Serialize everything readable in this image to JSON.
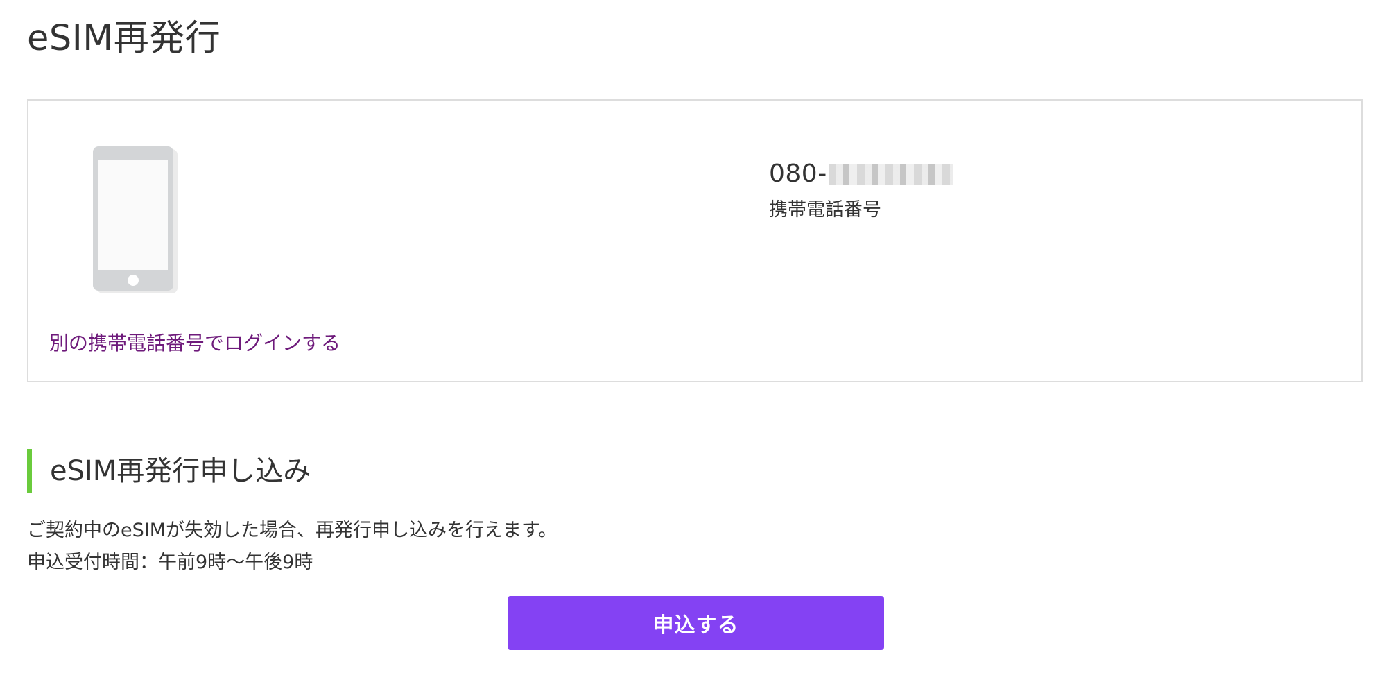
{
  "page": {
    "title": "eSIM再発行"
  },
  "account": {
    "phone_number_prefix": "080-",
    "phone_number_label": "携帯電話番号",
    "other_login_link": "別の携帯電話番号でログインする",
    "device_icon": "smartphone-icon"
  },
  "reissue_section": {
    "title": "eSIM再発行申し込み",
    "accent_color": "#6acb3c",
    "description_line1": "ご契約中のeSIMが失効した場合、再発行申し込みを行えます。",
    "description_line2": "申込受付時間：午前9時〜午後9時",
    "apply_button_label": "申込する",
    "apply_button_color": "#8442f3"
  },
  "colors": {
    "link": "#6e1a7b",
    "card_border": "#dddddd",
    "text": "#333333"
  }
}
